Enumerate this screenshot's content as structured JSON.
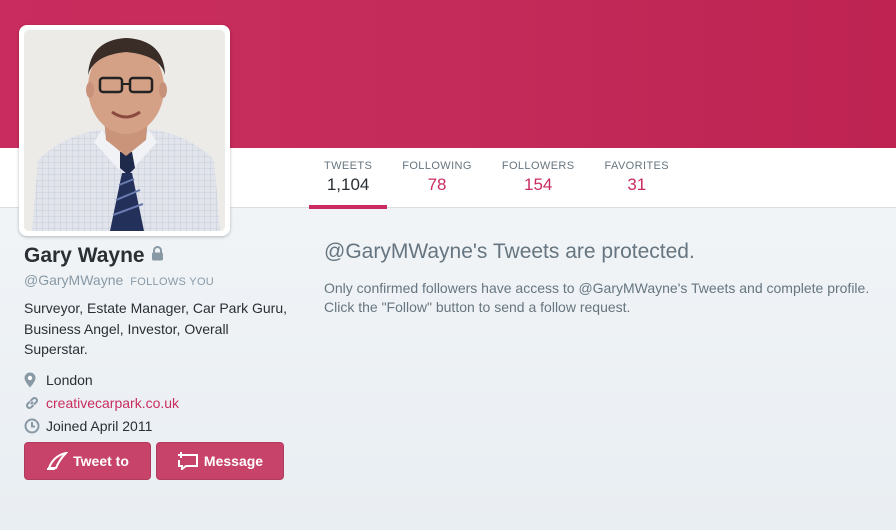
{
  "profile": {
    "name": "Gary Wayne",
    "handle": "@GaryMWayne",
    "follows_you": "FOLLOWS YOU",
    "bio": "Surveyor, Estate Manager, Car Park Guru, Business Angel, Investor, Overall Superstar.",
    "location": "London",
    "website": "creativecarpark.co.uk",
    "joined": "Joined April 2011",
    "protected_icon": "lock-icon"
  },
  "stats": [
    {
      "label": "TWEETS",
      "value": "1,104",
      "active": true
    },
    {
      "label": "FOLLOWING",
      "value": "78",
      "active": false
    },
    {
      "label": "FOLLOWERS",
      "value": "154",
      "active": false
    },
    {
      "label": "FAVORITES",
      "value": "31",
      "active": false
    }
  ],
  "actions": {
    "tweet_to_label": "Tweet to",
    "message_label": "Message"
  },
  "protected_notice": {
    "title": "@GaryMWayne's Tweets are protected.",
    "body": "Only confirmed followers have access to @GaryMWayne's Tweets and complete profile. Click the \"Follow\" button to send a follow request."
  },
  "colors": {
    "theme": "#c92c5e",
    "button": "#c8436a",
    "muted_text": "#66757f"
  },
  "icons": [
    "lock-icon",
    "location-pin-icon",
    "link-icon",
    "clock-icon",
    "compose-icon",
    "message-icon"
  ]
}
